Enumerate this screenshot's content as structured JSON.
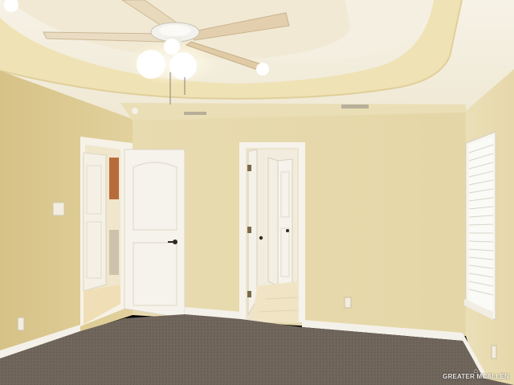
{
  "scene": {
    "description_label": "",
    "watermark": "GREATER MCALLEN",
    "colors": {
      "wall": "#e6d7a8",
      "wall_shadow": "#d9c690",
      "ceiling": "#f3eee0",
      "tray": "#efe4bf",
      "carpet": "#6e645a",
      "trim": "#f4f1ea",
      "door": "#f3f0e8",
      "tile": "#efe3c3"
    }
  }
}
